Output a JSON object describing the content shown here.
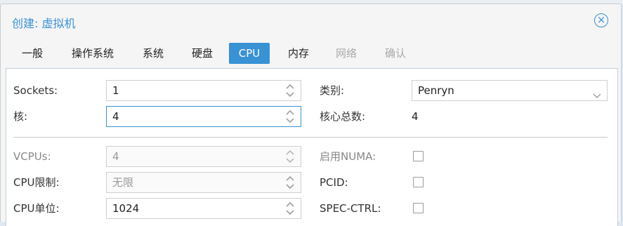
{
  "dialog": {
    "title": "创建: 虚拟机"
  },
  "tabs": [
    {
      "label": "一般"
    },
    {
      "label": "操作系统"
    },
    {
      "label": "系统"
    },
    {
      "label": "硬盘"
    },
    {
      "label": "CPU",
      "active": true
    },
    {
      "label": "内存"
    },
    {
      "label": "网络",
      "disabled": true
    },
    {
      "label": "确认",
      "disabled": true
    }
  ],
  "cpu": {
    "sockets_label": "Sockets:",
    "sockets_value": "1",
    "cores_label": "核:",
    "cores_value": "4",
    "type_label": "类别:",
    "type_value": "Penryn",
    "total_cores_label": "核心总数:",
    "total_cores_value": "4",
    "vcpus_label": "VCPUs:",
    "vcpus_value": "4",
    "cpu_limit_label": "CPU限制:",
    "cpu_limit_value": "无限",
    "cpu_units_label": "CPU单位:",
    "cpu_units_value": "1024",
    "numa_label": "启用NUMA:",
    "numa_checked": false,
    "pcid_label": "PCID:",
    "pcid_checked": false,
    "spec_ctrl_label": "SPEC-CTRL:",
    "spec_ctrl_checked": false
  },
  "colors": {
    "accent": "#3892d4",
    "border": "#cfcfcf",
    "text": "#333333"
  },
  "icons": {
    "close": "close-circle-icon",
    "spinner": "spinner-arrows-icon",
    "dropdown": "chevron-down-icon"
  }
}
